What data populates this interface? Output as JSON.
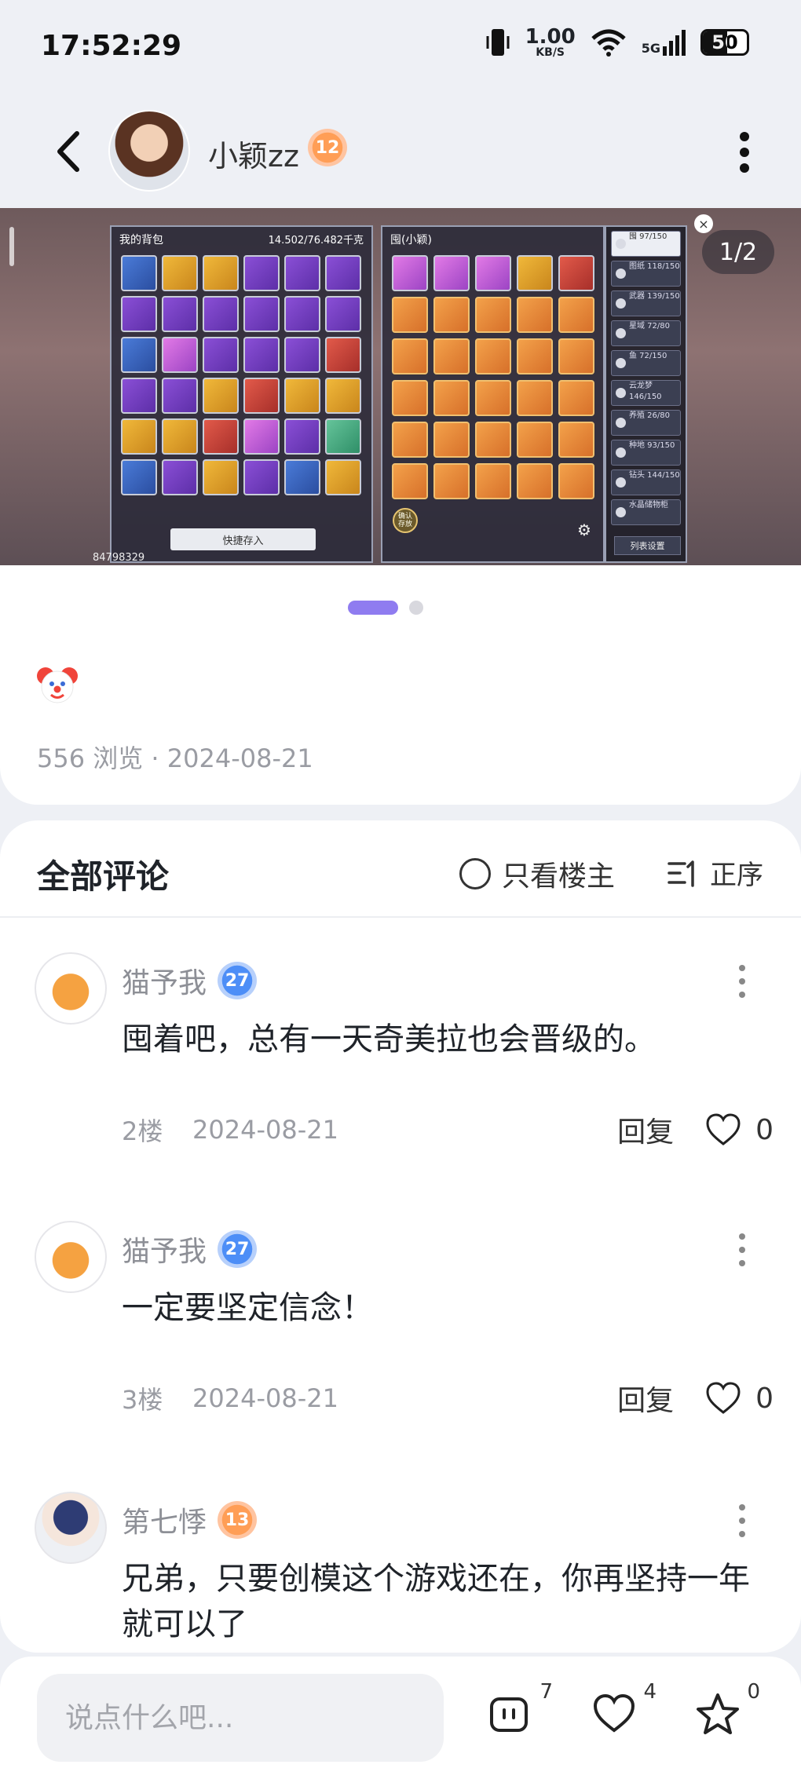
{
  "status_bar": {
    "time": "17:52:29",
    "net_speed_value": "1.00",
    "net_speed_unit": "KB/S",
    "network": "5G",
    "battery": "50",
    "icons": [
      "vibrate-icon",
      "wifi-icon",
      "signal-icon",
      "battery-icon"
    ]
  },
  "header": {
    "username": "小颖zz",
    "level": "12",
    "icons": [
      "back-arrow-icon",
      "more-vertical-icon"
    ]
  },
  "gallery": {
    "page_indicator": "1/2",
    "current_page": 1,
    "total_pages": 2,
    "image_texts": {
      "left_title": "我的背包",
      "left_capacity": "14.502/76.482千克",
      "left_button": "快捷存入",
      "mid_title": "囤(小颖)",
      "side_items": [
        "囤 97/150",
        "图纸 118/150",
        "武器 139/150",
        "星域 72/80",
        "鱼 72/150",
        "云龙梦 146/150",
        "养殖 26/80",
        "种地 93/150",
        "钻头 144/150",
        "水晶储物柜"
      ],
      "side_button": "列表设置",
      "confirm_button": "确认 存放",
      "player_id": "84798329"
    }
  },
  "post": {
    "emoji": "clown-face",
    "views_and_date": "556 浏览 · 2024-08-21"
  },
  "comments_section": {
    "title": "全部评论",
    "only_owner_label": "只看楼主",
    "sort_label": "正序",
    "comments": [
      {
        "name": "猫予我",
        "level": "27",
        "text": "囤着吧，总有一天奇美拉也会晋级的。",
        "floor": "2楼",
        "date": "2024-08-21",
        "reply_label": "回复",
        "likes": "0"
      },
      {
        "name": "猫予我",
        "level": "27",
        "text": "一定要坚定信念！",
        "floor": "3楼",
        "date": "2024-08-21",
        "reply_label": "回复",
        "likes": "0"
      },
      {
        "name": "第七悸",
        "level": "13",
        "text": "兄弟，只要创模这个游戏还在，你再坚持一年就可以了",
        "floor": "",
        "date": "",
        "reply_label": "",
        "likes": ""
      }
    ]
  },
  "bottom_bar": {
    "input_placeholder": "说点什么吧...",
    "comment_count": "7",
    "like_count": "4",
    "favorite_count": "0"
  },
  "colors": {
    "accent": "#8f7cf0",
    "background": "#eef0f5",
    "level_orange": "#ff9e56",
    "level_blue": "#4d8ef7"
  }
}
